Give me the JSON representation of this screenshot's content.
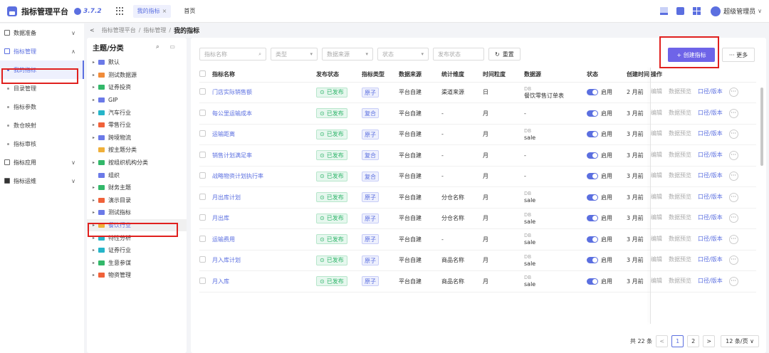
{
  "app": {
    "title": "指标管理平台",
    "version": "3.7.2"
  },
  "tabs": [
    {
      "label": "我的指标",
      "close": "×"
    },
    {
      "label": "首页"
    }
  ],
  "user": {
    "name": "超级管理员",
    "chevron": "∨"
  },
  "sidebar": {
    "groups": [
      {
        "label": "数据准备"
      },
      {
        "label": "指标管理"
      },
      {
        "label": "指标应用"
      },
      {
        "label": "指标运维"
      }
    ],
    "items": [
      {
        "label": "我的指标"
      },
      {
        "label": "目录管理"
      },
      {
        "label": "指标参数"
      },
      {
        "label": "数仓映射"
      },
      {
        "label": "指标审核"
      }
    ]
  },
  "breadcrumb": {
    "back": "<",
    "items": [
      "指标管理平台",
      "指标管理"
    ],
    "sep": "/",
    "current": "我的指标"
  },
  "tree": {
    "title": "主题/分类",
    "icons": "⌕ ▭",
    "nodes": [
      {
        "label": "默认",
        "color": "#6b7ae8"
      },
      {
        "label": "测试数据源",
        "color": "#f08c3a"
      },
      {
        "label": "证券投资",
        "color": "#33b86a"
      },
      {
        "label": "GIP",
        "color": "#6b7ae8"
      },
      {
        "label": "汽车行业",
        "color": "#26b5c9"
      },
      {
        "label": "零售行业",
        "color": "#f0623a"
      },
      {
        "label": "跨境物流",
        "color": "#6b7ae8"
      },
      {
        "label": "按主题分类",
        "color": "#f0b03a"
      },
      {
        "label": "按组织机构分类",
        "color": "#33b86a"
      },
      {
        "label": "组织",
        "color": "#6b7ae8"
      },
      {
        "label": "财务主题",
        "color": "#33b86a"
      },
      {
        "label": "演示目录",
        "color": "#f0623a"
      },
      {
        "label": "测试指标",
        "color": "#6b7ae8"
      },
      {
        "label": "餐饮行业",
        "color": "#f0b03a"
      },
      {
        "label": "特性分析",
        "color": "#26b5c9"
      },
      {
        "label": "证券行业",
        "color": "#26b5c9"
      },
      {
        "label": "生意参谋",
        "color": "#33b86a"
      },
      {
        "label": "物资管理",
        "color": "#f0623a"
      }
    ]
  },
  "filters": {
    "name_placeholder": "指标名称",
    "type_placeholder": "类型",
    "source_placeholder": "数据来源",
    "status_placeholder": "状态",
    "pubstatus_placeholder": "发布状态",
    "reset": "重置",
    "create": "+ 创建指标",
    "more": "··· 更多"
  },
  "table": {
    "headers": [
      "指标名称",
      "发布状态",
      "指标类型",
      "数据来源",
      "统计维度",
      "时间粒度",
      "数据源",
      "状态",
      "创建时间",
      "操作"
    ],
    "ops": [
      "编辑",
      "数据预览",
      "口径/版本"
    ],
    "rows": [
      {
        "name": "门店实际销售额",
        "pub": "已发布",
        "type": "原子",
        "source": "平台自建",
        "dim": "渠道来源",
        "grain": "日",
        "ds1": "DB",
        "ds2": "餐饮零售订单表",
        "status": "启用",
        "created": "2 月前"
      },
      {
        "name": "每公里运输成本",
        "pub": "已发布",
        "type": "复合",
        "source": "平台自建",
        "dim": "-",
        "grain": "月",
        "ds1": "",
        "ds2": "-",
        "status": "启用",
        "created": "3 月前"
      },
      {
        "name": "运输距离",
        "pub": "已发布",
        "type": "原子",
        "source": "平台自建",
        "dim": "-",
        "grain": "月",
        "ds1": "DB",
        "ds2": "sale",
        "status": "启用",
        "created": "3 月前"
      },
      {
        "name": "销售计划满足率",
        "pub": "已发布",
        "type": "复合",
        "source": "平台自建",
        "dim": "-",
        "grain": "月",
        "ds1": "",
        "ds2": "-",
        "status": "启用",
        "created": "3 月前"
      },
      {
        "name": "战略物资计划执行率",
        "pub": "已发布",
        "type": "复合",
        "source": "平台自建",
        "dim": "-",
        "grain": "月",
        "ds1": "",
        "ds2": "-",
        "status": "启用",
        "created": "3 月前"
      },
      {
        "name": "月出库计划",
        "pub": "已发布",
        "type": "原子",
        "source": "平台自建",
        "dim": "分仓名称",
        "grain": "月",
        "ds1": "DB",
        "ds2": "sale",
        "status": "启用",
        "created": "3 月前"
      },
      {
        "name": "月出库",
        "pub": "已发布",
        "type": "原子",
        "source": "平台自建",
        "dim": "分仓名称",
        "grain": "月",
        "ds1": "DB",
        "ds2": "sale",
        "status": "启用",
        "created": "3 月前"
      },
      {
        "name": "运输费用",
        "pub": "已发布",
        "type": "原子",
        "source": "平台自建",
        "dim": "-",
        "grain": "月",
        "ds1": "DB",
        "ds2": "sale",
        "status": "启用",
        "created": "3 月前"
      },
      {
        "name": "月入库计划",
        "pub": "已发布",
        "type": "原子",
        "source": "平台自建",
        "dim": "商品名称",
        "grain": "月",
        "ds1": "DB",
        "ds2": "sale",
        "status": "启用",
        "created": "3 月前"
      },
      {
        "name": "月入库",
        "pub": "已发布",
        "type": "原子",
        "source": "平台自建",
        "dim": "商品名称",
        "grain": "月",
        "ds1": "DB",
        "ds2": "sale",
        "status": "启用",
        "created": "3 月前"
      }
    ]
  },
  "pagination": {
    "total": "共 22 条",
    "prev": "<",
    "pages": [
      "1",
      "2"
    ],
    "next": ">",
    "size": "12 条/页 ∨"
  },
  "colors": {
    "accent": "#5b6fe0",
    "create": "#6e64e8",
    "highlight": "#e0201e",
    "success": "#2fb56a"
  }
}
